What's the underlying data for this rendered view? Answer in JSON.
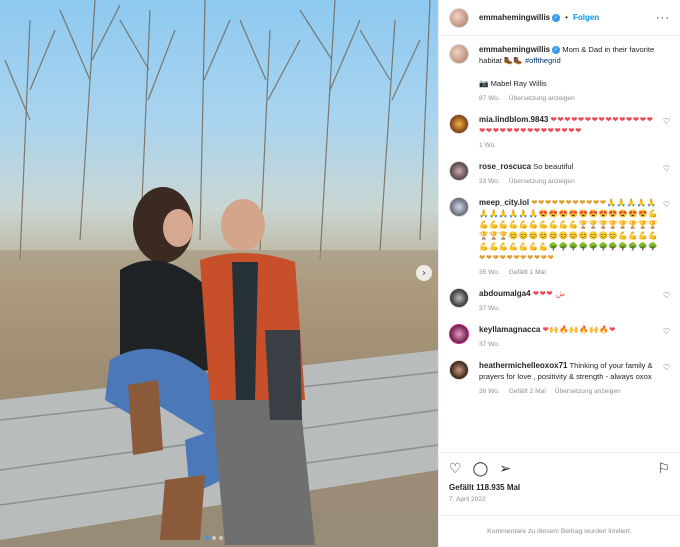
{
  "photo": {
    "alt_dots": 3,
    "next_arrow": "chevron-right-icon"
  },
  "header": {
    "username": "emmahemingwillis",
    "follow_label": "Folgen",
    "separator": "•",
    "more": "···"
  },
  "caption": {
    "username": "emmahemingwillis",
    "text": "Mom & Dad in their favorite habitat 🥾🥾 ",
    "hashtag": "#offthegrid",
    "credit": "📷 Mabel Ray Willis",
    "time": "87 Wo.",
    "translate": "Übersetzung anzeigen"
  },
  "comments": [
    {
      "user": "mia.lindblom.9843",
      "text": "❤❤❤❤❤❤❤❤❤❤❤❤❤❤❤❤❤❤❤❤❤❤❤❤❤❤❤❤❤❤",
      "time": "1 Wo.",
      "likes": "",
      "reply": ""
    },
    {
      "user": "rose_roscuca",
      "text": "So beautiful",
      "time": "33 Wo.",
      "likes": "",
      "reply": "Übersetzung anzeigen"
    },
    {
      "user": "meep_city.lol",
      "text": "❤❤❤❤❤❤❤❤❤❤❤🙏🙏🙏🙏🙏🙏🙏🙏🙏🙏🙏😍😍😍😍😍😍😍😍😍😍😍💪💪💪💪💪💪💪💪💪💪💪🏆🏆🏆🏆🏆🏆🏆🏆🏆🏆🏆😊😊😊😊😊😊😊😊😊😊😊💪💪💪💪💪💪💪💪💪💪💪🌳🌳🌳🌳🌳🌳🌳🌳🌳🌳🌳❤❤❤❤❤❤❤❤❤❤❤",
      "time": "35 Wo.",
      "likes": "Gefällt 1 Mal",
      "reply": ""
    },
    {
      "user": "abdoumalga4",
      "text": "❤❤❤ ش",
      "time": "37 Wo.",
      "likes": "",
      "reply": ""
    },
    {
      "user": "keyllamagnacca",
      "text": "❤🙌🔥🙌🔥🙌🔥❤",
      "time": "37 Wo.",
      "likes": "",
      "reply": ""
    },
    {
      "user": "heathermichelleoxox71",
      "text": "Thinking of your family & prayers for love , positivity & strength - always oxox",
      "time": "39 Wo.",
      "likes": "Gefällt 2 Mal",
      "reply": "Übersetzung anzeigen"
    }
  ],
  "actions": {
    "likes": "Gefällt 118.935 Mal",
    "date": "7. April 2022",
    "limited": "Kommentare zu diesem Beitrag wurden limitiert."
  },
  "colors": {
    "accent": "#0095f6",
    "verified": "#3897f0",
    "heart": "#ed4956"
  }
}
